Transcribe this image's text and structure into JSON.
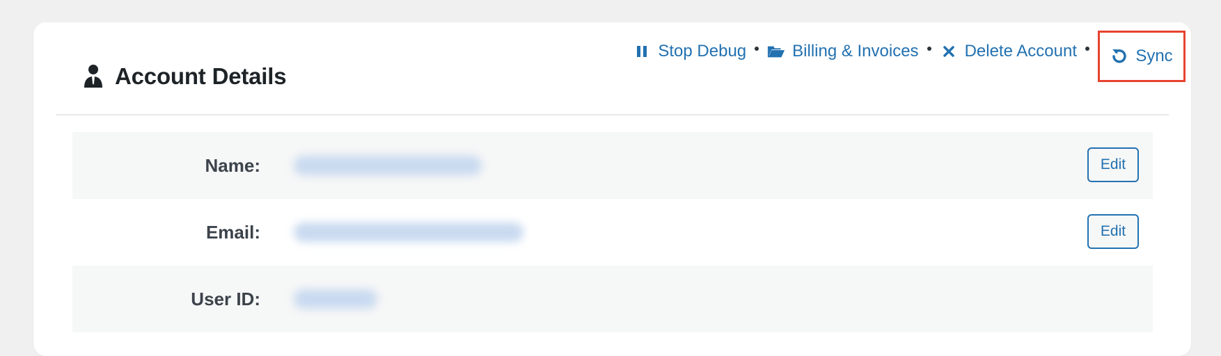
{
  "header": {
    "title": "Account Details",
    "icon": "user-icon"
  },
  "actions": {
    "stop_debug": {
      "label": "Stop Debug",
      "icon": "pause-icon"
    },
    "billing": {
      "label": "Billing & Invoices",
      "icon": "folder-open-icon"
    },
    "delete_account": {
      "label": "Delete Account",
      "icon": "close-icon"
    },
    "sync": {
      "label": "Sync",
      "icon": "refresh-icon"
    }
  },
  "fields": [
    {
      "label": "Name:",
      "edit_label": "Edit"
    },
    {
      "label": "Email:",
      "edit_label": "Edit"
    },
    {
      "label": "User ID:"
    }
  ],
  "colors": {
    "link": "#2271b1",
    "highlight": "#e8422f"
  }
}
